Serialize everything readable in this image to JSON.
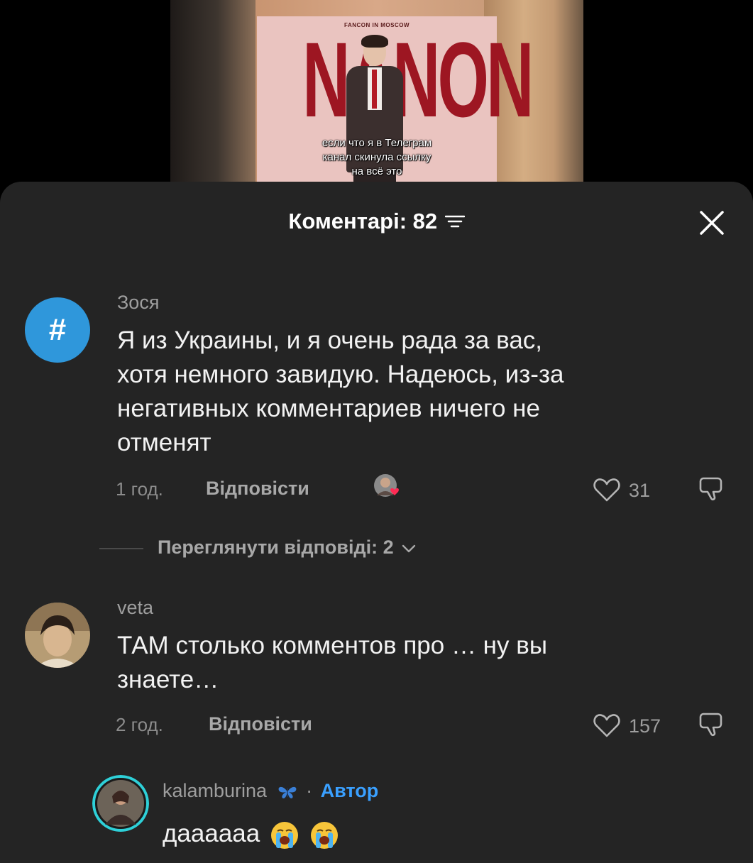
{
  "video": {
    "poster_top": "FANCON IN MOSCOW",
    "poster_title": "NANON",
    "caption_lines": [
      "если что я в Телеграм",
      "канал скинула ссылку",
      "на всё это"
    ]
  },
  "sheet": {
    "title": "Коментарі: 82",
    "sort_icon": "sort-lines-icon",
    "close_icon": "close-x-icon"
  },
  "comments": [
    {
      "username": "Зося",
      "avatar_symbol": "#",
      "text": [
        "Я из Украины, и я очень рада за вас,",
        "хотя немного завидую. Надеюсь, из-за",
        "негативных комментариев ничего не",
        "отменят"
      ],
      "time": "1 год.",
      "reply": "Відповісти",
      "likes": "31",
      "view_replies": "Переглянути відповіді: 2"
    },
    {
      "username": "veta",
      "text": [
        "ТАМ столько комментов про … ну вы",
        "знаете…"
      ],
      "time": "2 год.",
      "reply": "Відповісти",
      "likes": "157"
    },
    {
      "username": "kalamburina",
      "author_label": "Автор",
      "separator": "·",
      "text": "даааааа"
    }
  ],
  "colors": {
    "sheet_bg": "#242424",
    "accent_blue": "#3aa0ff",
    "hash_avatar": "#2f97db"
  }
}
